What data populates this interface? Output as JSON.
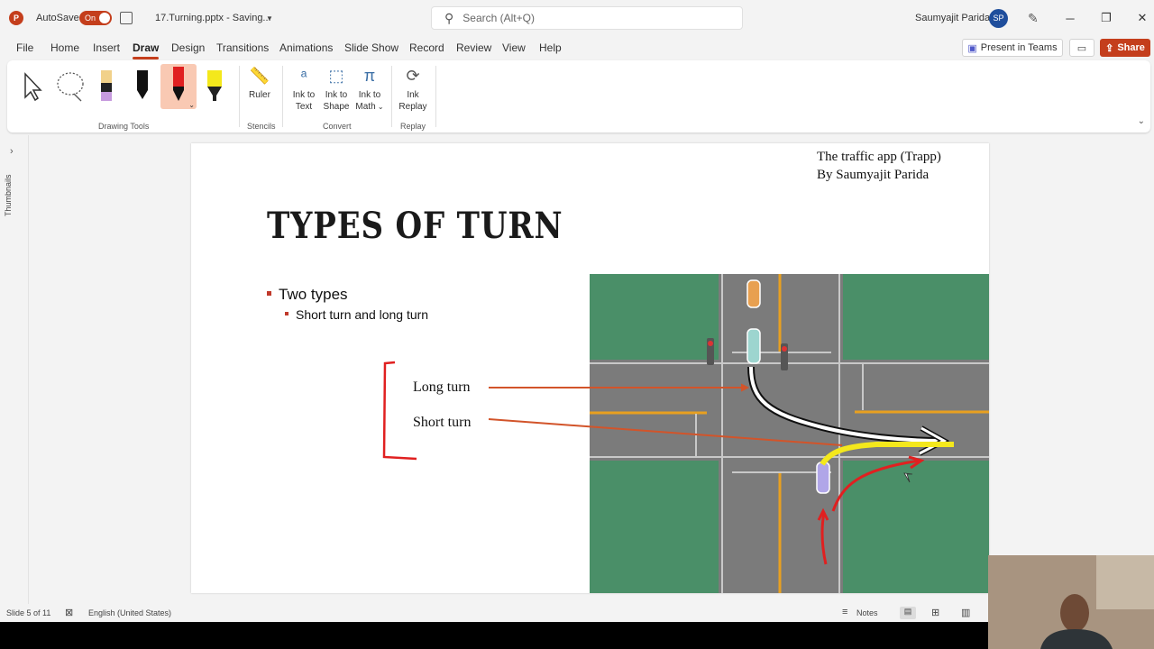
{
  "titlebar": {
    "app_logo": "P",
    "autosave_label": "AutoSave",
    "autosave_state": "On",
    "filename": "17.Turning.pptx  -  Saving...",
    "search_placeholder": "Search (Alt+Q)",
    "user_name": "Saumyajit Parida",
    "user_initials": "SP"
  },
  "menu": {
    "tabs": [
      "File",
      "Home",
      "Insert",
      "Draw",
      "Design",
      "Transitions",
      "Animations",
      "Slide Show",
      "Record",
      "Review",
      "View",
      "Help"
    ],
    "active_tab": "Draw",
    "present_label": "Present in Teams",
    "share_label": "Share"
  },
  "ribbon": {
    "groups": {
      "drawing_tools": "Drawing Tools",
      "stencils": "Stencils",
      "convert": "Convert",
      "replay": "Replay"
    },
    "ruler": "Ruler",
    "ink_to_text": "Ink to Text",
    "ink_to_shape": "Ink to Shape",
    "ink_to_math": "Ink to Math",
    "ink_replay": "Ink Replay"
  },
  "thumbnails_label": "Thumbnails",
  "slide": {
    "credit_line1": "The traffic app (Trapp)",
    "credit_line2": "By Saumyajit Parida",
    "title": "TYPES OF TURN",
    "bullet_1": "Two types",
    "bullet_2": "Short turn and long turn",
    "label_long": "Long turn",
    "label_short": "Short turn"
  },
  "status": {
    "slide_indicator": "Slide 5 of 11",
    "language": "English (United States)",
    "notes": "Notes"
  },
  "colors": {
    "accent": "#c43e1c",
    "grass": "#4a8f68",
    "road": "#7b7b7b",
    "lane_yellow": "#e8a020",
    "ink_red": "#e02020",
    "ink_yellow": "#f4e81c"
  }
}
